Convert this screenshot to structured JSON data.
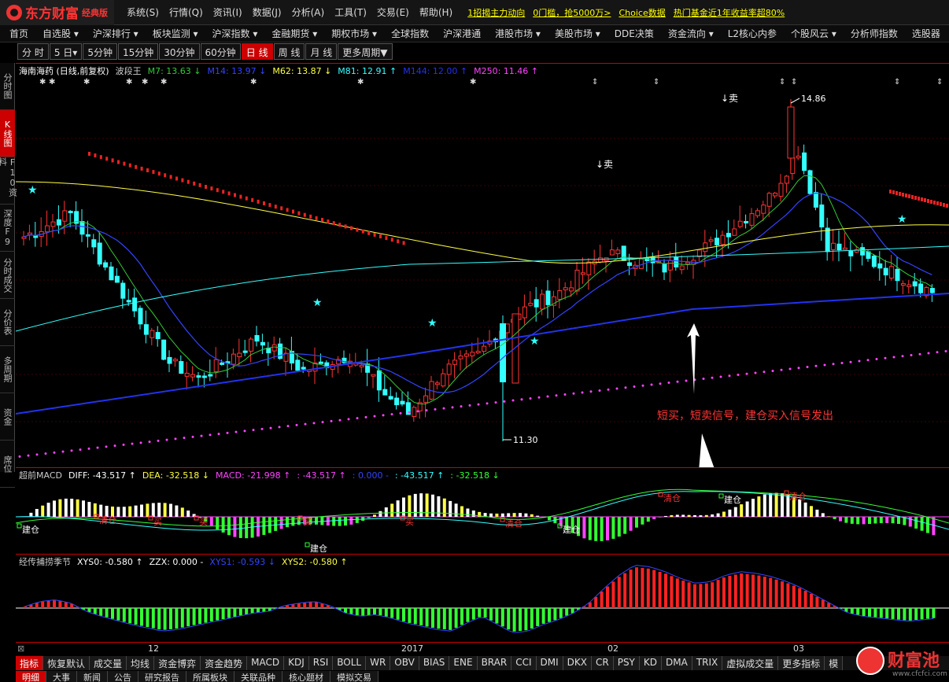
{
  "app": {
    "name": "东方财富",
    "edition": "经典版"
  },
  "menu": [
    "系统(S)",
    "行情(Q)",
    "资讯(I)",
    "数据(J)",
    "分析(A)",
    "工具(T)",
    "交易(E)",
    "帮助(H)"
  ],
  "news": [
    "1招揭主力动向",
    "0门槛，抢5000万>",
    "Choice数据",
    "热门基金近1年收益率超80%"
  ],
  "nav": [
    "首页",
    "自选股 ▾",
    "沪深排行 ▾",
    "板块监测 ▾",
    "沪深指数 ▾",
    "金融期货 ▾",
    "期权市场 ▾",
    "全球指数",
    "沪深港通",
    "港股市场 ▾",
    "美股市场 ▾",
    "DDE决策",
    "资金流向 ▾",
    "L2核心内参",
    "个股风云 ▾",
    "分析师指数",
    "选股器"
  ],
  "periods": [
    {
      "label": "分 时",
      "active": false
    },
    {
      "label": "5 日▾",
      "active": false
    },
    {
      "label": "5分钟",
      "active": false
    },
    {
      "label": "15分钟",
      "active": false
    },
    {
      "label": "30分钟",
      "active": false
    },
    {
      "label": "60分钟",
      "active": false
    },
    {
      "label": "日 线",
      "active": true
    },
    {
      "label": "周 线",
      "active": false
    },
    {
      "label": "月 线",
      "active": false
    },
    {
      "label": "更多周期▼",
      "active": false
    }
  ],
  "sidetabs": [
    {
      "label": "分时图",
      "active": false
    },
    {
      "label": "K线图",
      "active": true
    },
    {
      "label": "F10资料",
      "active": false
    },
    {
      "label": "深度F9",
      "active": false
    },
    {
      "label": "分时成交",
      "active": false
    },
    {
      "label": "分价表",
      "active": false
    },
    {
      "label": "多周期",
      "active": false
    },
    {
      "label": "资金",
      "active": false
    },
    {
      "label": "席位",
      "active": false
    }
  ],
  "main_legend": [
    {
      "text": "海南海药 (日线,前复权)",
      "color": "#ffffff"
    },
    {
      "text": "波段王",
      "color": "#cccccc"
    },
    {
      "text": "M7: 13.63 ↓",
      "color": "#33cc33"
    },
    {
      "text": "M14: 13.97 ↓",
      "color": "#3344ff"
    },
    {
      "text": "M62: 13.87 ↓",
      "color": "#ffff44"
    },
    {
      "text": "M81: 12.91 ↑",
      "color": "#33ffff"
    },
    {
      "text": "M144: 12.00 ↑",
      "color": "#2233ee"
    },
    {
      "text": "M250: 11.46 ↑",
      "color": "#ff44ff"
    }
  ],
  "main_annotations": {
    "high": "14.86",
    "low": "11.30",
    "sell1": "↓卖",
    "sell2": "↓卖",
    "note": "短买，短卖信号，建仓买入信号发出"
  },
  "macd_legend": [
    {
      "text": "超前MACD",
      "color": "#cccccc"
    },
    {
      "text": "DIFF: -43.517 ↑",
      "color": "#ffffff"
    },
    {
      "text": "DEA: -32.518 ↓",
      "color": "#ffff44"
    },
    {
      "text": "MACD: -21.998 ↑",
      "color": "#ff44ff"
    },
    {
      "text": ": -43.517 ↑",
      "color": "#ff44ff"
    },
    {
      "text": ": 0.000 -",
      "color": "#3344ff"
    },
    {
      "text": ": -43.517 ↑",
      "color": "#33ffff"
    },
    {
      "text": ": -32.518 ↓",
      "color": "#33ff33"
    }
  ],
  "macd_labels": {
    "build": "建仓",
    "clear": "清仓",
    "buy": "买"
  },
  "xys_legend": [
    {
      "text": "经传捕捞季节",
      "color": "#cccccc"
    },
    {
      "text": "XYS0: -0.580 ↑",
      "color": "#ffffff"
    },
    {
      "text": "ZZX: 0.000 -",
      "color": "#ffffff"
    },
    {
      "text": "XYS1: -0.593 ↓",
      "color": "#3344ff"
    },
    {
      "text": "XYS2: -0.580 ↑",
      "color": "#ffff44"
    }
  ],
  "xaxis": [
    "12",
    "2017",
    "02",
    "03"
  ],
  "indicator_tabs": [
    {
      "label": "指标",
      "active": true
    },
    {
      "label": "恢复默认",
      "active": false
    },
    {
      "label": "成交量",
      "active": false
    },
    {
      "label": "均线",
      "active": false
    },
    {
      "label": "资金博弈",
      "active": false
    },
    {
      "label": "资金趋势",
      "active": false
    },
    {
      "label": "MACD",
      "active": false
    },
    {
      "label": "KDJ",
      "active": false
    },
    {
      "label": "RSI",
      "active": false
    },
    {
      "label": "BOLL",
      "active": false
    },
    {
      "label": "WR",
      "active": false
    },
    {
      "label": "OBV",
      "active": false
    },
    {
      "label": "BIAS",
      "active": false
    },
    {
      "label": "ENE",
      "active": false
    },
    {
      "label": "BRAR",
      "active": false
    },
    {
      "label": "CCI",
      "active": false
    },
    {
      "label": "DMI",
      "active": false
    },
    {
      "label": "DKX",
      "active": false
    },
    {
      "label": "CR",
      "active": false
    },
    {
      "label": "PSY",
      "active": false
    },
    {
      "label": "KD",
      "active": false
    },
    {
      "label": "DMA",
      "active": false
    },
    {
      "label": "TRIX",
      "active": false
    },
    {
      "label": "虚拟成交量",
      "active": false
    },
    {
      "label": "更多指标",
      "active": false
    },
    {
      "label": "模",
      "active": false
    }
  ],
  "info_tabs": [
    {
      "label": "明细",
      "active": true
    },
    {
      "label": "大事",
      "active": false
    },
    {
      "label": "新闻",
      "active": false
    },
    {
      "label": "公告",
      "active": false
    },
    {
      "label": "研究报告",
      "active": false
    },
    {
      "label": "所属板块",
      "active": false
    },
    {
      "label": "关联品种",
      "active": false
    },
    {
      "label": "核心题材",
      "active": false
    },
    {
      "label": "模拟交易",
      "active": false
    }
  ],
  "watermark": {
    "text": "财富池",
    "sub": "www.cfcfci.com"
  },
  "colors": {
    "up": "#ff3333",
    "down": "#33ffff",
    "accent": "#cc0000"
  }
}
